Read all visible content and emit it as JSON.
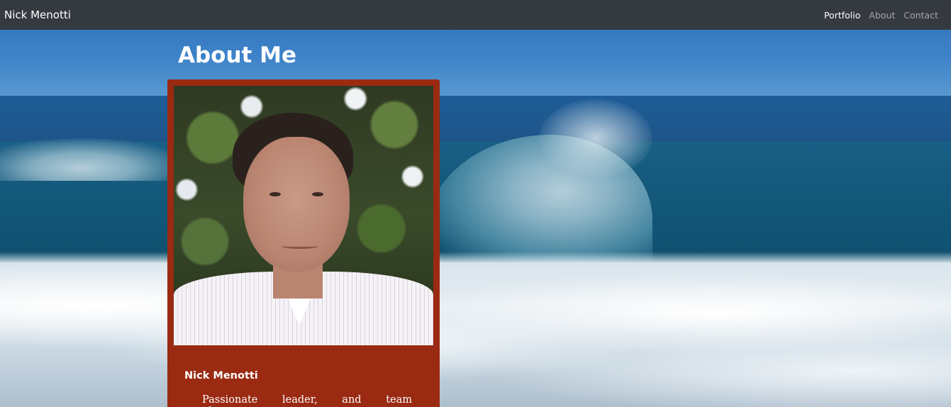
{
  "navbar": {
    "brand": "Nick Menotti",
    "links": [
      {
        "label": "Portfolio",
        "active": true
      },
      {
        "label": "About",
        "active": false
      },
      {
        "label": "Contact",
        "active": false
      }
    ]
  },
  "main": {
    "title": "About Me",
    "card": {
      "name": "Nick Menotti",
      "text": "Passionate leader, and team player"
    }
  },
  "colors": {
    "navbar_bg": "#343a40",
    "card_bg": "#9a2a12"
  }
}
